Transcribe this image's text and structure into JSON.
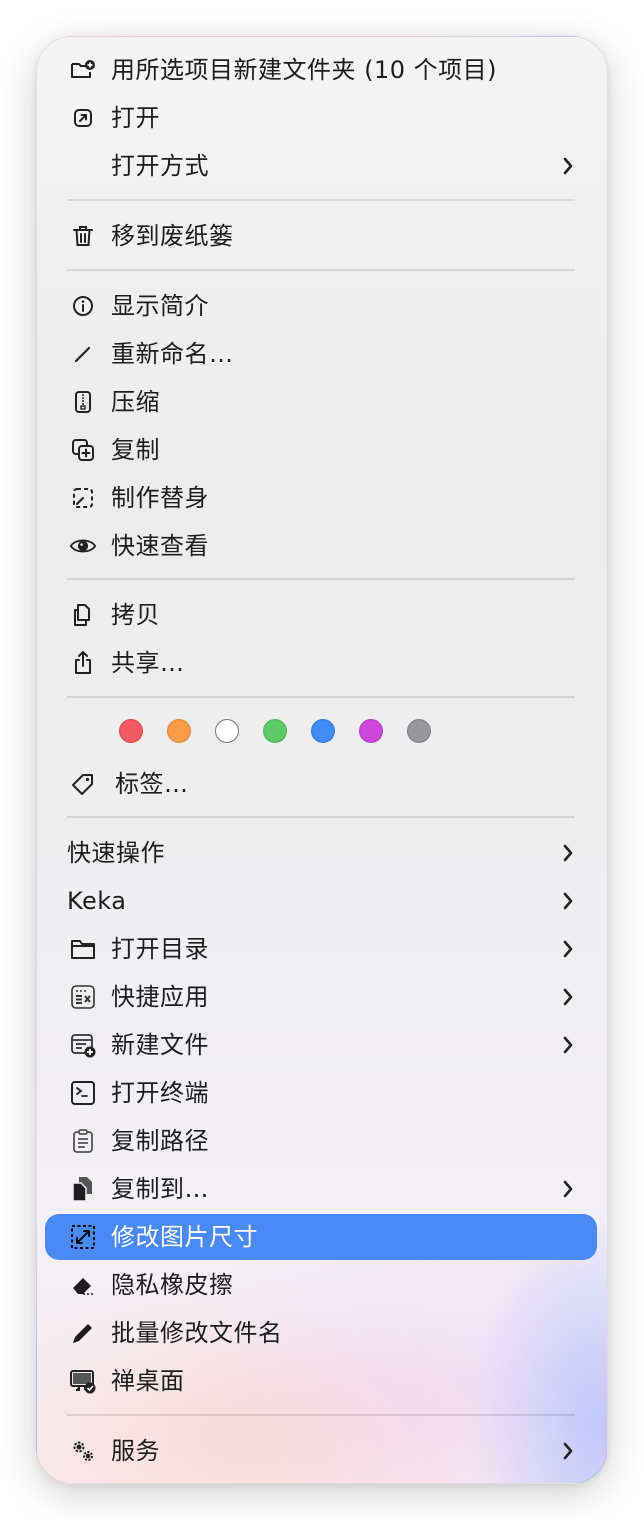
{
  "menu": {
    "items": {
      "new_folder": "用所选项目新建文件夹 (10 个项目)",
      "open": "打开",
      "open_with": "打开方式",
      "move_to_trash": "移到废纸篓",
      "get_info": "显示简介",
      "rename": "重新命名…",
      "compress": "压缩",
      "duplicate": "复制",
      "make_alias": "制作替身",
      "quick_look": "快速查看",
      "copy": "拷贝",
      "share": "共享…",
      "tags": "标签…",
      "quick_actions": "快速操作",
      "keka": "Keka",
      "open_directory": "打开目录",
      "shortcuts": "快捷应用",
      "new_file": "新建文件",
      "open_terminal": "打开终端",
      "copy_path": "复制路径",
      "copy_to": "复制到…",
      "resize_image": "修改图片尺寸",
      "privacy_eraser": "隐私橡皮擦",
      "batch_rename": "批量修改文件名",
      "zen_desktop": "禅桌面",
      "services": "服务"
    },
    "tag_colors": [
      "#f25a5f",
      "#f99c45",
      "#ffffff",
      "#5ccb67",
      "#3f8cf6",
      "#cd47dc",
      "#97979b"
    ],
    "highlighted_item": "修改图片尺寸",
    "icons": {
      "new_folder": "folder-plus-icon",
      "open": "open-arrow-icon",
      "move_to_trash": "trash-icon",
      "get_info": "info-icon",
      "rename": "pencil-icon",
      "compress": "zip-icon",
      "duplicate": "duplicate-icon",
      "make_alias": "alias-icon",
      "quick_look": "eye-icon",
      "copy": "copy-docs-icon",
      "share": "share-icon",
      "tags": "tag-icon",
      "open_directory": "folder-icon",
      "shortcuts": "shortcuts-icon",
      "new_file": "new-file-icon",
      "open_terminal": "terminal-icon",
      "copy_path": "clipboard-icon",
      "copy_to": "copy-to-icon",
      "resize_image": "resize-icon",
      "privacy_eraser": "eraser-icon",
      "batch_rename": "batch-rename-icon",
      "zen_desktop": "monitor-icon",
      "services": "gears-icon"
    }
  }
}
